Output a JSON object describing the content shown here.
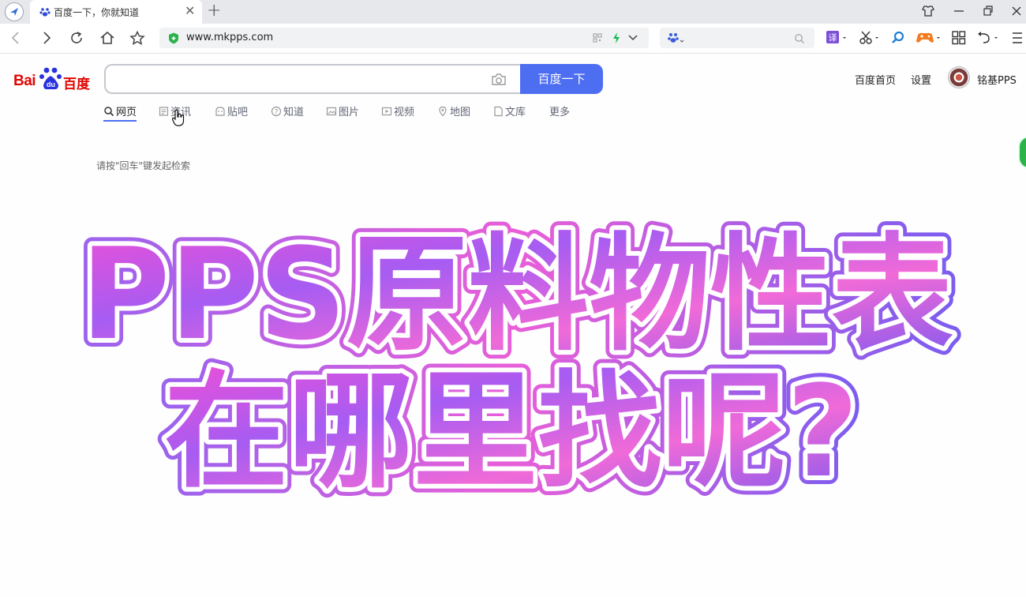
{
  "browser": {
    "tab_title": "百度一下，你就知道",
    "url": "www.mkpps.com"
  },
  "baidu": {
    "logo_latin": "Bai",
    "logo_du": "du",
    "logo_cn": "百度",
    "search_button": "百度一下",
    "top_links": {
      "home": "百度首页",
      "settings": "设置",
      "username": "铭基PPS"
    },
    "nav_tabs": [
      {
        "label": "网页",
        "icon": "search-icon"
      },
      {
        "label": "资讯",
        "icon": "news-icon"
      },
      {
        "label": "贴吧",
        "icon": "tieba-icon"
      },
      {
        "label": "知道",
        "icon": "question-icon"
      },
      {
        "label": "图片",
        "icon": "image-icon"
      },
      {
        "label": "视频",
        "icon": "video-icon"
      },
      {
        "label": "地图",
        "icon": "map-icon"
      },
      {
        "label": "文库",
        "icon": "doc-icon"
      },
      {
        "label": "更多",
        "icon": ""
      }
    ],
    "hint": "请按\"回车\"键发起检索"
  },
  "overlay": {
    "line1": "PPS原料物性表",
    "line2": "在哪里找呢?"
  },
  "colors": {
    "baidu_red": "#e10602",
    "baidu_blue": "#4e6ef2",
    "title_pink": "#f04fd6",
    "title_purple": "#7a58f0"
  }
}
